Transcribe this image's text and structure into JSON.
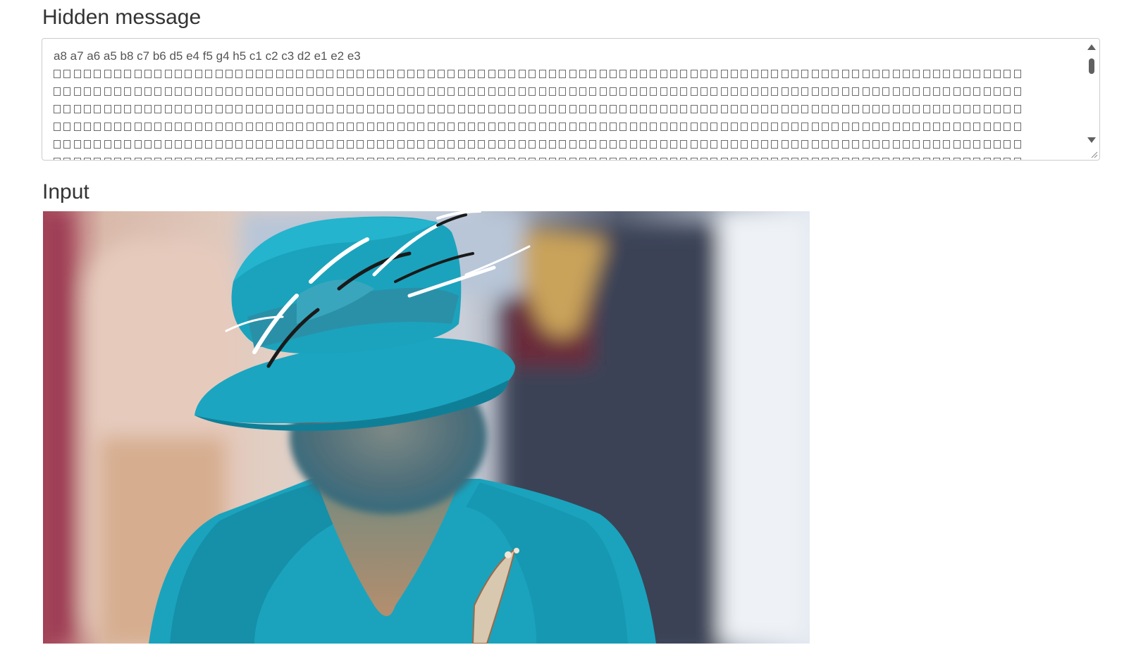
{
  "hidden_message": {
    "heading": "Hidden message",
    "first_line": "a8 a7 a6 a5 b8 c7 b6 d5 e4 f5 g4 h5 c1 c2 c3 d2 e1 e2 e3"
  },
  "input": {
    "heading": "Input"
  },
  "icons": {
    "scroll_up": "triangle-up-icon",
    "scroll_down": "triangle-down-icon",
    "resize": "resize-grip-icon"
  },
  "colors": {
    "heading_text": "#333333",
    "border": "#cccccc",
    "hat_teal": "#1ba3bd"
  }
}
